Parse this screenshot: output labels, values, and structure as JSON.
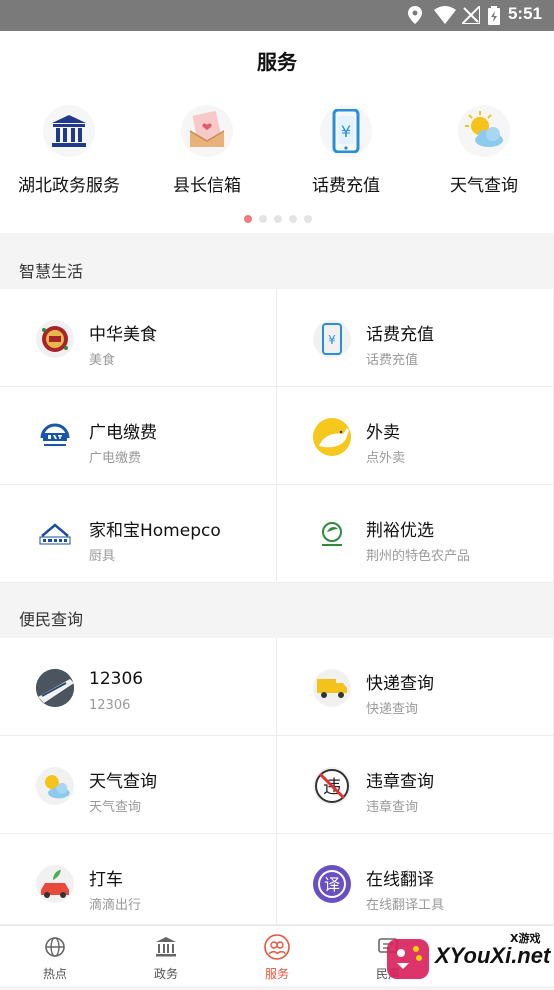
{
  "status_bar": {
    "time": "5:51"
  },
  "header": {
    "title": "服务"
  },
  "carousel": {
    "items": [
      {
        "label": "湖北政务服务",
        "icon": "government-building-icon"
      },
      {
        "label": "县长信箱",
        "icon": "mailbox-icon"
      },
      {
        "label": "话费充值",
        "icon": "phone-recharge-icon"
      },
      {
        "label": "天气查询",
        "icon": "weather-icon"
      }
    ],
    "page_count": 5,
    "active_page": 1
  },
  "smart_life": {
    "title": "智慧生活",
    "items": [
      {
        "name": "中华美食",
        "sub": "美食"
      },
      {
        "name": "话费充值",
        "sub": "话费充值"
      },
      {
        "name": "广电缴费",
        "sub": "广电缴费"
      },
      {
        "name": "外卖",
        "sub": "点外卖"
      },
      {
        "name": "家和宝Homepco",
        "sub": "厨具"
      },
      {
        "name": "荆裕优选",
        "sub": "荆州的特色农产品"
      }
    ]
  },
  "convenience": {
    "title": "便民查询",
    "items": [
      {
        "name": "12306",
        "sub": "12306"
      },
      {
        "name": "快递查询",
        "sub": "快递查询"
      },
      {
        "name": "天气查询",
        "sub": "天气查询"
      },
      {
        "name": "违章查询",
        "sub": "违章查询"
      },
      {
        "name": "打车",
        "sub": "滴滴出行"
      },
      {
        "name": "在线翻译",
        "sub": "在线翻译工具"
      }
    ]
  },
  "tabbar": {
    "tabs": [
      {
        "label": "热点"
      },
      {
        "label": "政务"
      },
      {
        "label": "服务"
      },
      {
        "label": "民声"
      }
    ],
    "active": "服务"
  },
  "watermark": {
    "brand": "XYouXi.net",
    "small": "X游戏"
  },
  "colors": {
    "accent": "#e8553e",
    "dot_active": "#f07b7b"
  }
}
